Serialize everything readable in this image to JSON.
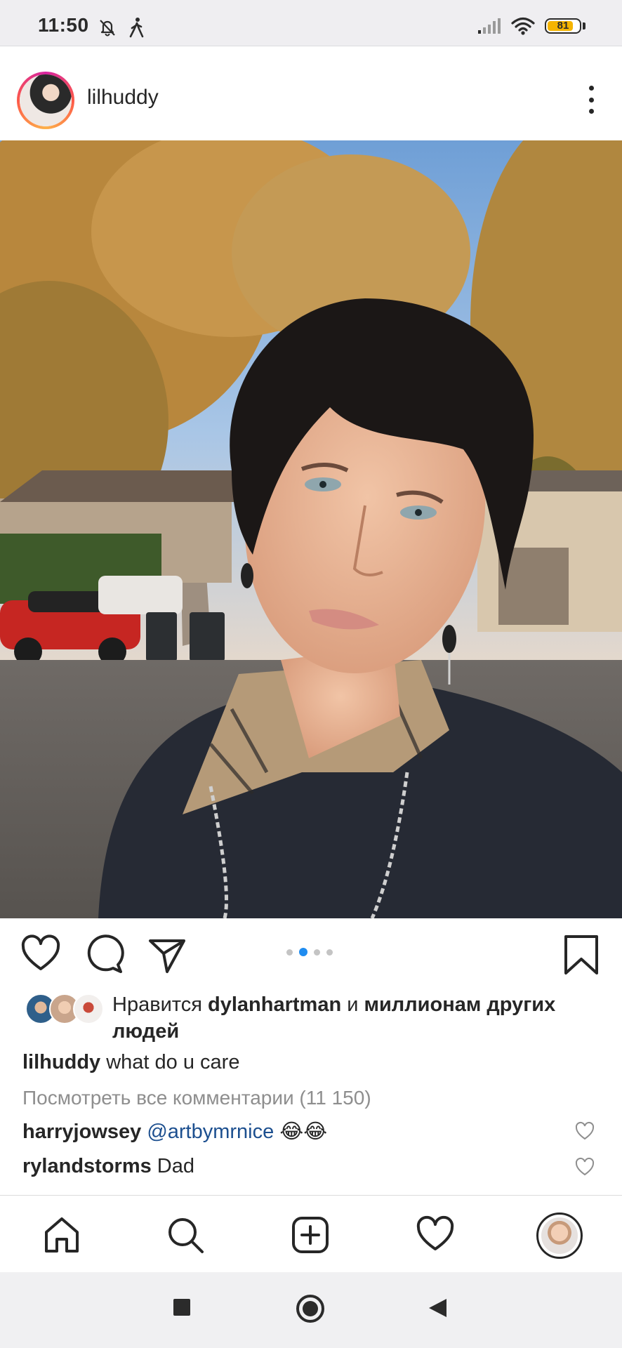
{
  "status_bar": {
    "time": "11:50",
    "battery_level": "81",
    "battery_fraction": 0.81,
    "icons": [
      "mute-bell-icon",
      "walking-icon",
      "signal-icon",
      "wifi-icon",
      "battery-icon"
    ]
  },
  "post": {
    "username": "lilhuddy",
    "carousel": {
      "count": 4,
      "active_index": 1
    },
    "likes": {
      "prefix": "Нравится ",
      "liker": "dylanhartman",
      "joiner": " и ",
      "rest": "миллионам других людей"
    },
    "caption": {
      "username": "lilhuddy",
      "text": "what do u care"
    },
    "view_all_comments": "Посмотреть все комментарии (11 150)",
    "comments": [
      {
        "username": "harryjowsey",
        "mention": "@artbymrnice",
        "text": "😂😂"
      },
      {
        "username": "rylandstorms",
        "mention": "",
        "text": "Dad"
      }
    ]
  },
  "colors": {
    "accent_blue": "#1f8cf0",
    "mention_blue": "#1c4f8f",
    "muted_text": "#8e8e8e",
    "battery_yellow": "#f5b400"
  },
  "nav_icons": [
    "home-icon",
    "search-icon",
    "add-post-icon",
    "activity-heart-icon",
    "profile-avatar"
  ],
  "system_nav_icons": [
    "recents-square-icon",
    "home-circle-icon",
    "back-triangle-icon"
  ]
}
